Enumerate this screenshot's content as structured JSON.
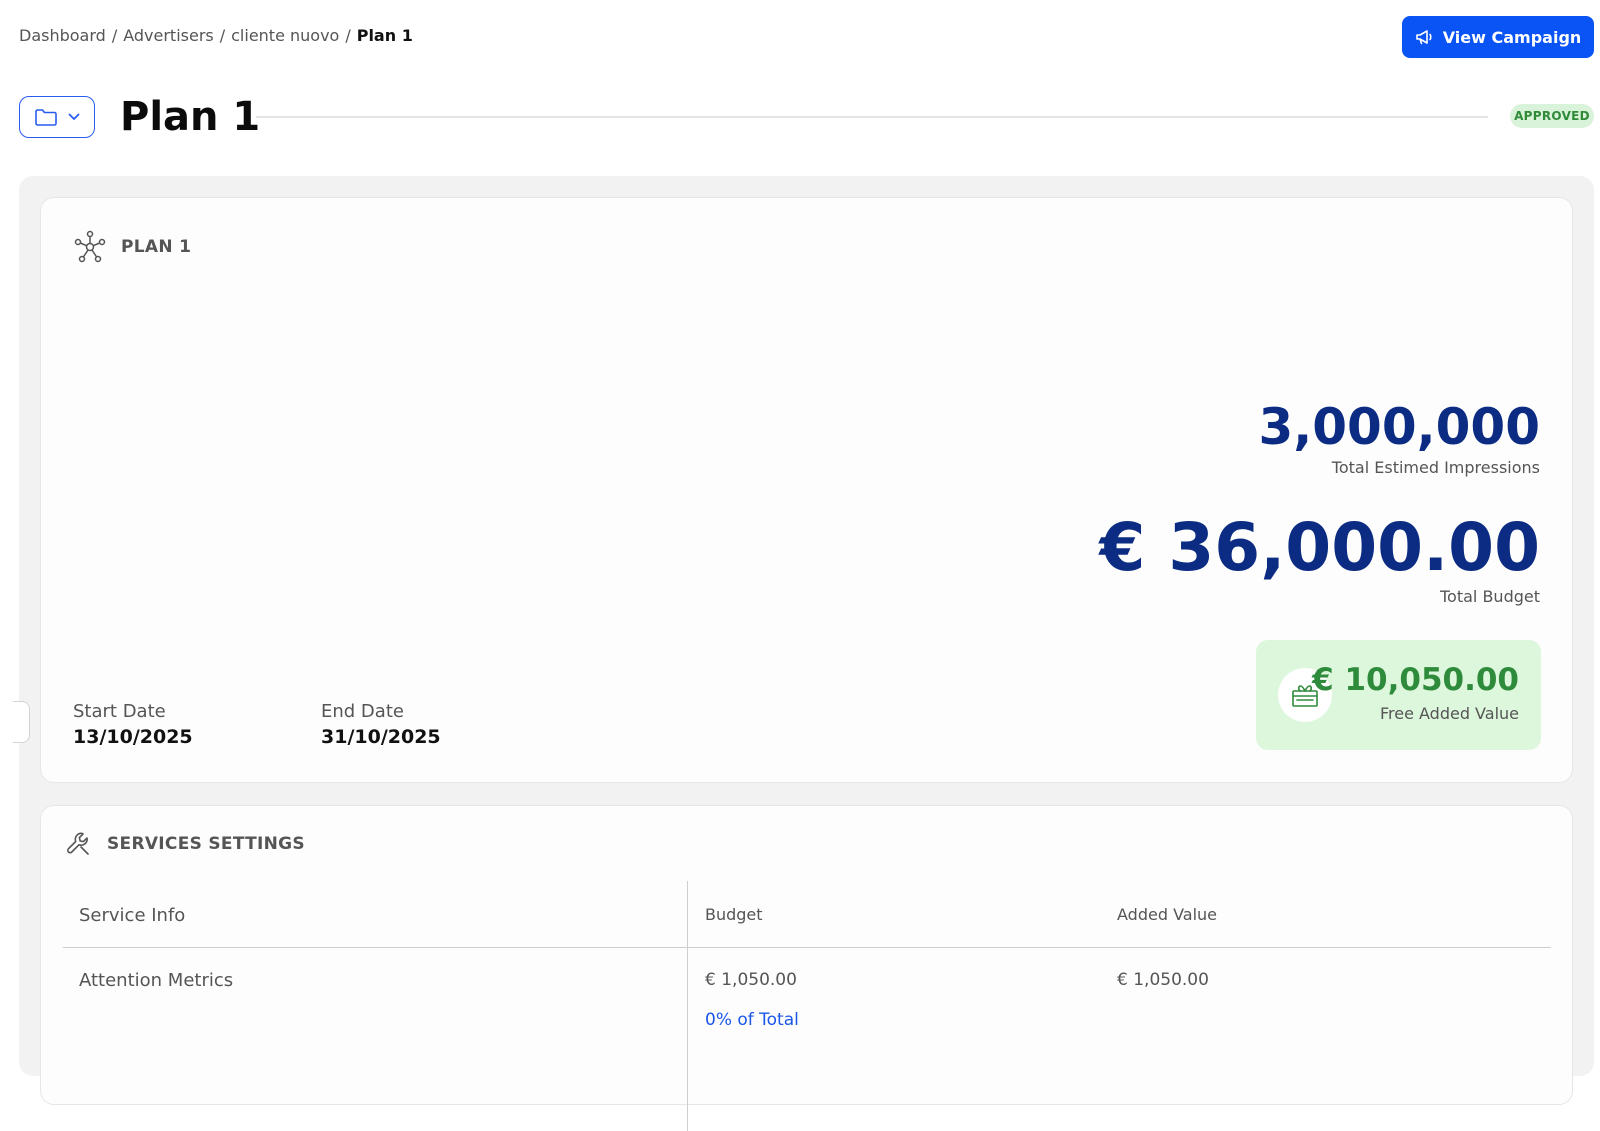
{
  "breadcrumb": {
    "items": [
      "Dashboard",
      "Advertisers",
      "cliente nuovo"
    ],
    "current": "Plan 1",
    "separator": "/"
  },
  "header": {
    "view_campaign_label": "View Campaign",
    "title": "Plan 1",
    "status": "APPROVED"
  },
  "plan_card": {
    "heading": "PLAN 1",
    "impressions_value": "3,000,000",
    "impressions_label": "Total Estimed Impressions",
    "budget_value": "€ 36,000.00",
    "budget_label": "Total Budget",
    "added_value": "€ 10,050.00",
    "added_label": "Free Added Value",
    "start_label": "Start Date",
    "start_value": "13/10/2025",
    "end_label": "End Date",
    "end_value": "31/10/2025"
  },
  "services": {
    "heading": "SERVICES SETTINGS",
    "columns": [
      "Service Info",
      "Budget",
      "Added Value"
    ],
    "rows": [
      {
        "service": "Attention Metrics",
        "budget": "€ 1,050.00",
        "share": "0% of Total",
        "added": "€ 1,050.00"
      }
    ]
  },
  "colors": {
    "primary": "#0a53f5",
    "metric_navy": "#0b2c82",
    "added_green": "#2e8b3b",
    "badge_bg": "#d9f2da",
    "added_bg": "#ddf7dc"
  },
  "icons": {
    "megaphone": "megaphone-icon",
    "folder": "folder-icon",
    "chevron": "chevron-down-icon",
    "network": "network-icon",
    "wrench": "wrench-icon",
    "gift": "gift-icon"
  }
}
